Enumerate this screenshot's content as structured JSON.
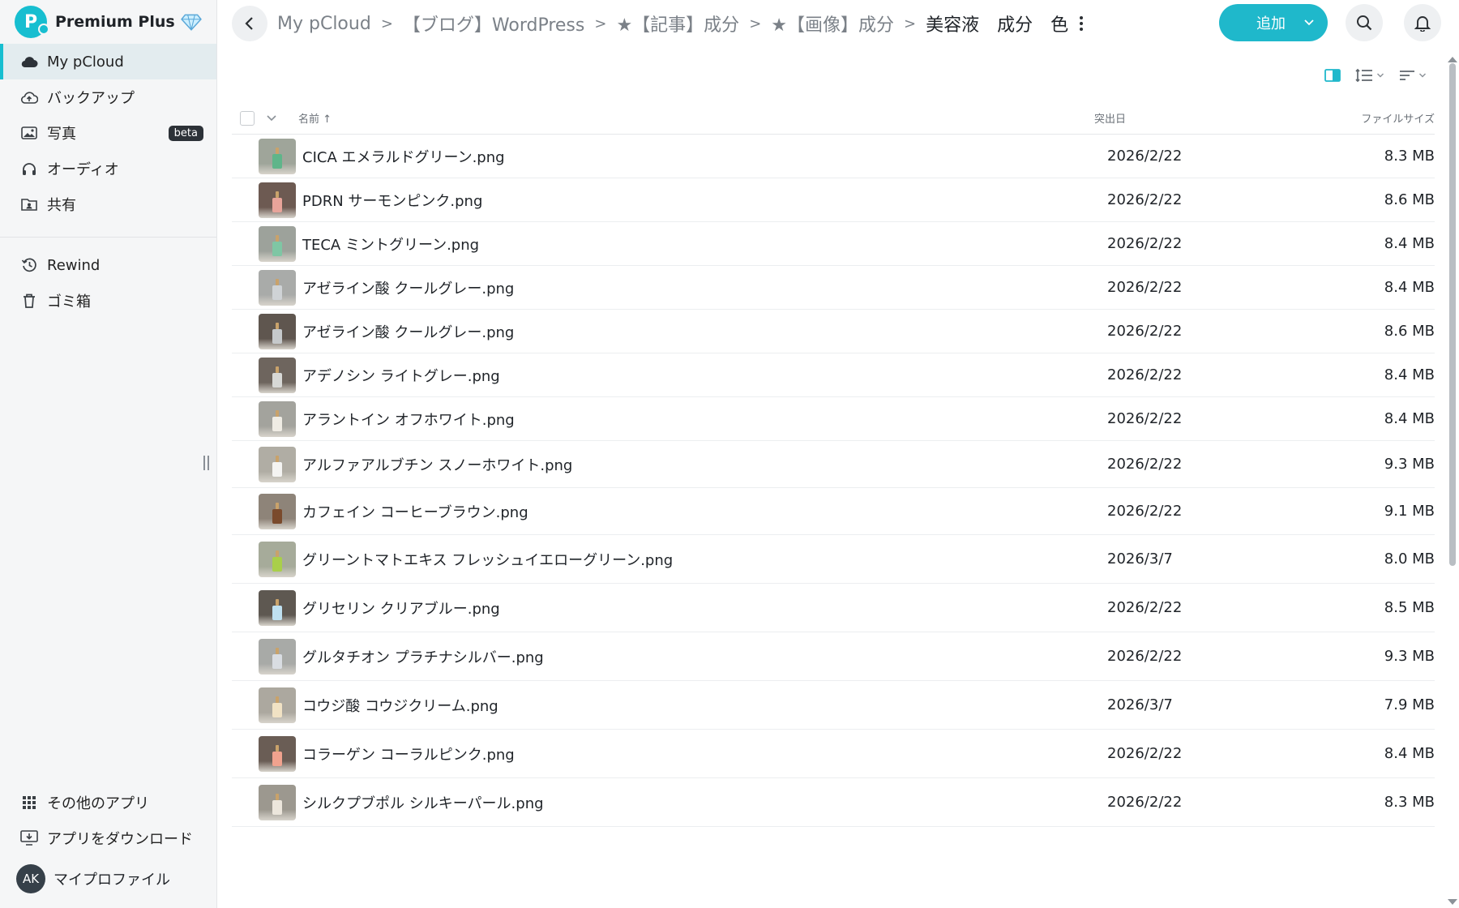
{
  "brand": {
    "logo_letter": "P",
    "plan": "Premium Plus"
  },
  "sidebar": {
    "items": [
      {
        "label": "My pCloud",
        "icon": "cloud-icon",
        "active": true
      },
      {
        "label": "バックアップ",
        "icon": "cloud-upload-icon"
      },
      {
        "label": "写真",
        "icon": "image-icon",
        "badge": "beta"
      },
      {
        "label": "オーディオ",
        "icon": "headphones-icon"
      },
      {
        "label": "共有",
        "icon": "shared-folder-icon"
      }
    ],
    "items2": [
      {
        "label": "Rewind",
        "icon": "history-icon"
      },
      {
        "label": "ゴミ箱",
        "icon": "trash-icon"
      }
    ],
    "bottom": [
      {
        "label": "その他のアプリ",
        "icon": "apps-grid-icon"
      },
      {
        "label": "アプリをダウンロード",
        "icon": "download-app-icon"
      }
    ],
    "profile": {
      "initials": "AK",
      "label": "マイプロファイル"
    }
  },
  "breadcrumb": [
    "My pCloud",
    "【ブログ】WordPress",
    "★【記事】成分",
    "★【画像】成分",
    "美容液　成分　色"
  ],
  "toolbar": {
    "add_label": "追加"
  },
  "list": {
    "headers": {
      "name": "名前 ↑",
      "date": "突出日",
      "size": "ファイルサイズ"
    },
    "rows": [
      {
        "name": "CICA エメラルドグリーン.png",
        "date": "2026/2/22",
        "size": "8.3 MB",
        "bg": "#9fa59a",
        "liquid": "#5fb58a"
      },
      {
        "name": "PDRN サーモンピンク.png",
        "date": "2026/2/22",
        "size": "8.6 MB",
        "bg": "#6d5a52",
        "liquid": "#e8a49a"
      },
      {
        "name": "TECA ミントグリーン.png",
        "date": "2026/2/22",
        "size": "8.4 MB",
        "bg": "#9da29b",
        "liquid": "#7fc6a4"
      },
      {
        "name": "アゼライン酸 クールグレー.png",
        "date": "2026/2/22",
        "size": "8.4 MB",
        "bg": "#a9aba9",
        "liquid": "#cfd3d6"
      },
      {
        "name": "アゼライン酸 クールグレー.png",
        "date": "2026/2/22",
        "size": "8.6 MB",
        "bg": "#5f564f",
        "liquid": "#c6c9cb"
      },
      {
        "name": "アデノシン ライトグレー.png",
        "date": "2026/2/22",
        "size": "8.4 MB",
        "bg": "#6e655e",
        "liquid": "#d7d8d6"
      },
      {
        "name": "アラントイン オフホワイト.png",
        "date": "2026/2/22",
        "size": "8.4 MB",
        "bg": "#a3a39d",
        "liquid": "#efece4"
      },
      {
        "name": "アルファアルブチン スノーホワイト.png",
        "date": "2026/2/22",
        "size": "9.3 MB",
        "bg": "#b0ada4",
        "liquid": "#f4f4f2"
      },
      {
        "name": "カフェイン コーヒーブラウン.png",
        "date": "2026/2/22",
        "size": "9.1 MB",
        "bg": "#8e8479",
        "liquid": "#7a4a2c"
      },
      {
        "name": "グリーントマトエキス フレッシュイエローグリーン.png",
        "date": "2026/3/7",
        "size": "8.0 MB",
        "bg": "#a6ab9a",
        "liquid": "#a9cf4a"
      },
      {
        "name": "グリセリン クリアブルー.png",
        "date": "2026/2/22",
        "size": "8.5 MB",
        "bg": "#5e5851",
        "liquid": "#bfe0f0"
      },
      {
        "name": "グルタチオン プラチナシルバー.png",
        "date": "2026/2/22",
        "size": "9.3 MB",
        "bg": "#a8aaa7",
        "liquid": "#d9dde2"
      },
      {
        "name": "コウジ酸 コウジクリーム.png",
        "date": "2026/3/7",
        "size": "7.9 MB",
        "bg": "#aca89f",
        "liquid": "#f1e2c4"
      },
      {
        "name": "コラーゲン コーラルピンク.png",
        "date": "2026/2/22",
        "size": "8.4 MB",
        "bg": "#6a5d55",
        "liquid": "#f0a28e"
      },
      {
        "name": "シルクプブポル シルキーパール.png",
        "date": "2026/2/22",
        "size": "8.3 MB",
        "bg": "#9c988f",
        "liquid": "#ece6dc"
      }
    ]
  },
  "colors": {
    "accent": "#1fb8cb",
    "active_bg": "#e3ecef"
  }
}
